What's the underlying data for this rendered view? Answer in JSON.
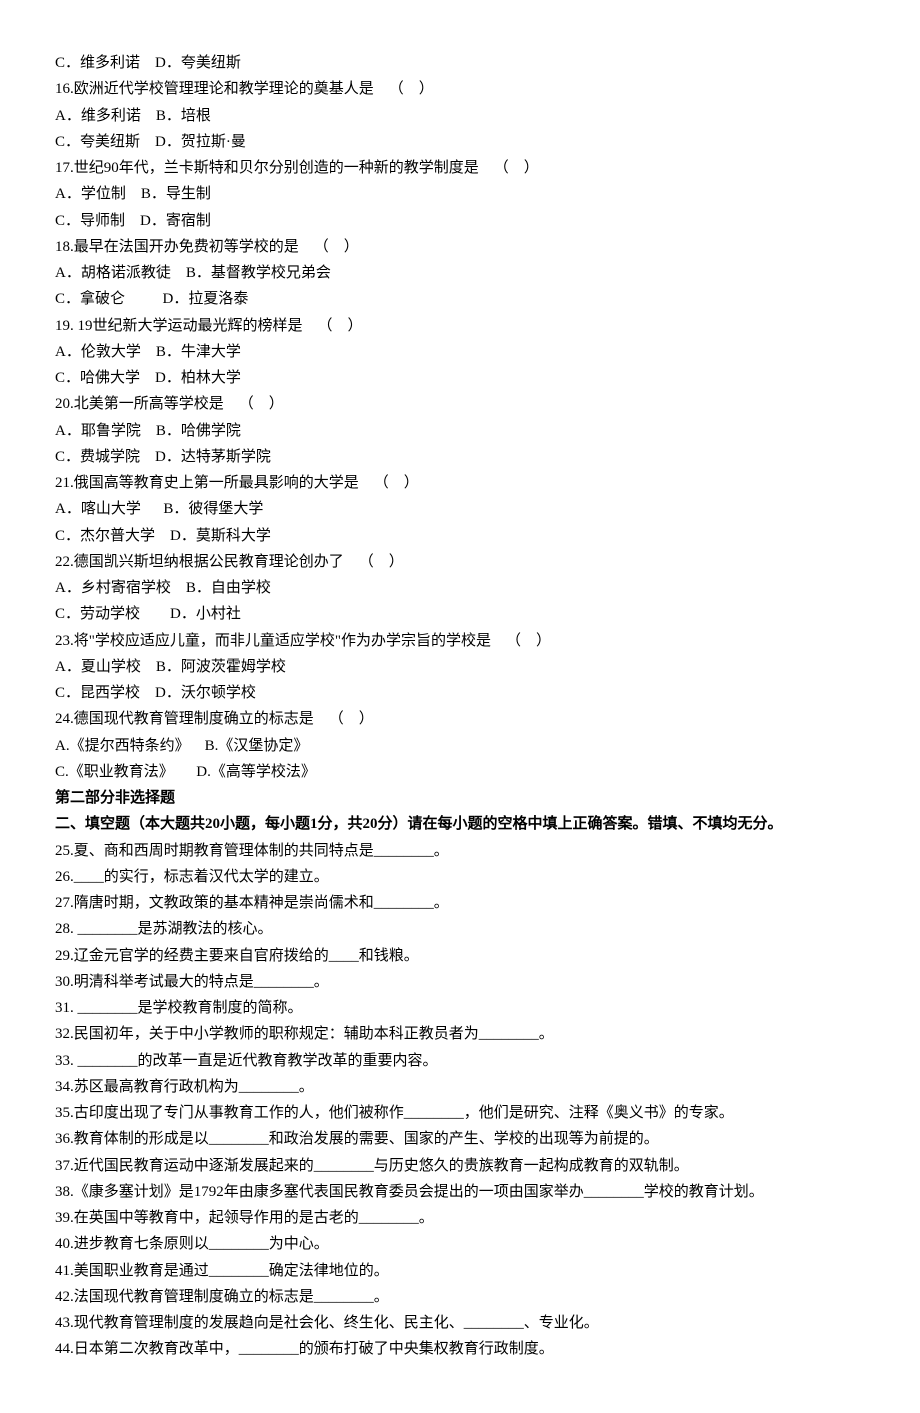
{
  "mc": {
    "q15_opts": "C．维多利诺    D．夸美纽斯",
    "q16": "16.欧洲近代学校管理理论和教学理论的奠基人是    （    ）",
    "q16_o1": "A．维多利诺    B．培根",
    "q16_o2": "C．夸美纽斯    D．贺拉斯·曼",
    "q17": "17.世纪90年代，兰卡斯特和贝尔分别创造的一种新的教学制度是    （    ）",
    "q17_o1": "A．学位制    B．导生制",
    "q17_o2": "C．导师制    D．寄宿制",
    "q18": "18.最早在法国开办免费初等学校的是    （    ）",
    "q18_o1": "A．胡格诺派教徒    B．基督教学校兄弟会",
    "q18_o2": "C．拿破仑          D．拉夏洛泰",
    "q19": "19. 19世纪新大学运动最光辉的榜样是    （    ）",
    "q19_o1": "A．伦敦大学    B．牛津大学",
    "q19_o2": "C．哈佛大学    D．柏林大学",
    "q20": "20.北美第一所高等学校是    （    ）",
    "q20_o1": "A．耶鲁学院    B．哈佛学院",
    "q20_o2": "C．费城学院    D．达特茅斯学院",
    "q21": "21.俄国高等教育史上第一所最具影响的大学是    （    ）",
    "q21_o1": "A．喀山大学      B．彼得堡大学",
    "q21_o2": "C．杰尔普大学    D．莫斯科大学",
    "q22": "22.德国凯兴斯坦纳根据公民教育理论创办了    （    ）",
    "q22_o1": "A．乡村寄宿学校    B．自由学校",
    "q22_o2": "C．劳动学校        D．小村社",
    "q23": "23.将\"学校应适应儿童，而非儿童适应学校\"作为办学宗旨的学校是    （    ）",
    "q23_o1": "A．夏山学校    B．阿波茨霍姆学校",
    "q23_o2": "C．昆西学校    D．沃尔顿学校",
    "q24": "24.德国现代教育管理制度确立的标志是    （    ）",
    "q24_o1": "A.《提尔西特条约》    B.《汉堡协定》",
    "q24_o2": "C.《职业教育法》      D.《高等学校法》"
  },
  "section2_title": "第二部分非选择题",
  "section2_instr": "二、填空题（本大题共20小题，每小题1分，共20分）请在每小题的空格中填上正确答案。错填、不填均无分。",
  "fb": {
    "q25": "25.夏、商和西周时期教育管理体制的共同特点是________。",
    "q26": "26.____的实行，标志着汉代太学的建立。",
    "q27": "27.隋唐时期，文教政策的基本精神是崇尚儒术和________。",
    "q28": "28. ________是苏湖教法的核心。",
    "q29": "29.辽金元官学的经费主要来自官府拨给的____和钱粮。",
    "q30": "30.明清科举考试最大的特点是________。",
    "q31": "31. ________是学校教育制度的简称。",
    "q32": "32.民国初年，关于中小学教师的职称规定：辅助本科正教员者为________。",
    "q33": "33. ________的改革一直是近代教育教学改革的重要内容。",
    "q34": "34.苏区最高教育行政机构为________。",
    "q35": "35.古印度出现了专门从事教育工作的人，他们被称作________，他们是研究、注释《奥义书》的专家。",
    "q36": "36.教育体制的形成是以________和政治发展的需要、国家的产生、学校的出现等为前提的。",
    "q37": "37.近代国民教育运动中逐渐发展起来的________与历史悠久的贵族教育一起构成教育的双轨制。",
    "q38": "38.《康多塞计划》是1792年由康多塞代表国民教育委员会提出的一项由国家举办________学校的教育计划。",
    "q39": "39.在英国中等教育中，起领导作用的是古老的________。",
    "q40": "40.进步教育七条原则以________为中心。",
    "q41": "41.美国职业教育是通过________确定法律地位的。",
    "q42": "42.法国现代教育管理制度确立的标志是________。",
    "q43": "43.现代教育管理制度的发展趋向是社会化、终生化、民主化、________、专业化。",
    "q44": "44.日本第二次教育改革中，________的颁布打破了中央集权教育行政制度。"
  }
}
